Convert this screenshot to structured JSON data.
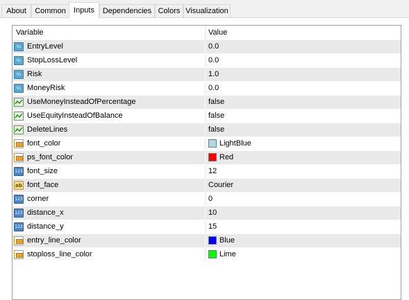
{
  "tabs": [
    {
      "label": "About"
    },
    {
      "label": "Common"
    },
    {
      "label": "Inputs"
    },
    {
      "label": "Dependencies"
    },
    {
      "label": "Colors"
    },
    {
      "label": "Visualization"
    }
  ],
  "active_tab": "Inputs",
  "table": {
    "columns": [
      "Variable",
      "Value"
    ],
    "rows": [
      {
        "icon": "double-variable-icon",
        "name": "EntryLevel",
        "value": "0.0"
      },
      {
        "icon": "double-variable-icon",
        "name": "StopLossLevel",
        "value": "0.0"
      },
      {
        "icon": "double-variable-icon",
        "name": "Risk",
        "value": "1.0"
      },
      {
        "icon": "double-variable-icon",
        "name": "MoneyRisk",
        "value": "0.0"
      },
      {
        "icon": "boolean-icon",
        "name": "UseMoneyInsteadOfPercentage",
        "value": "false"
      },
      {
        "icon": "boolean-icon",
        "name": "UseEquityInsteadOfBalance",
        "value": "false"
      },
      {
        "icon": "boolean-icon",
        "name": "DeleteLines",
        "value": "false"
      },
      {
        "icon": "color-icon",
        "name": "font_color",
        "value": "LightBlue",
        "swatch": "#add8e6"
      },
      {
        "icon": "color-icon",
        "name": "ps_font_color",
        "value": "Red",
        "swatch": "#ff0000"
      },
      {
        "icon": "integer-icon",
        "name": "font_size",
        "value": "12"
      },
      {
        "icon": "string-icon",
        "name": "font_face",
        "value": "Courier"
      },
      {
        "icon": "integer-icon",
        "name": "corner",
        "value": "0"
      },
      {
        "icon": "integer-icon",
        "name": "distance_x",
        "value": "10"
      },
      {
        "icon": "integer-icon",
        "name": "distance_y",
        "value": "15"
      },
      {
        "icon": "color-icon",
        "name": "entry_line_color",
        "value": "Blue",
        "swatch": "#0000ff"
      },
      {
        "icon": "color-icon",
        "name": "stoploss_line_color",
        "value": "Lime",
        "swatch": "#00ff00"
      }
    ]
  }
}
